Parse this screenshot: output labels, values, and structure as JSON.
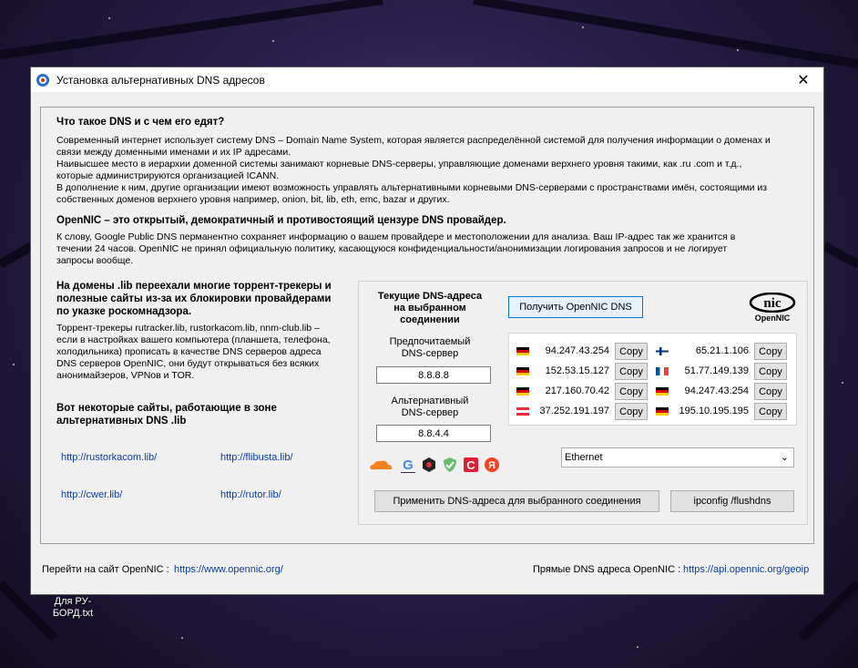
{
  "desktop": {
    "icon_label": "Для РУ-БОРД.txt"
  },
  "window": {
    "title": "Установка альтернативных DNS адресов",
    "close_glyph": "✕"
  },
  "intro": {
    "heading": "Что такое DNS и с чем его едят?",
    "lines": [
      "Современный интернет использует систему DNS – Domain Name System, которая является распределённой системой для получения информации о доменах и",
      "связи между доменными именами и их IP адресами.",
      "Наивысшее место в иерархии доменной системы занимают корневые DNS-серверы, управляющие доменами верхнего уровня такими, как .ru .com и т.д.,",
      "которые администрируются организацией ICANN.",
      "В дополнение к ним, другие организации имеют возможность управлять альтернативными корневыми DNS-серверами с пространствами имён, состоящими из",
      "собственных доменов верхнего уровня например, onion, bit, lib, eth, emc, bazar и других."
    ]
  },
  "opennic": {
    "heading": "OpenNIC – это открытый, демократичный и противостоящий цензуре DNS провайдер.",
    "lines": [
      "К слову, Google Public DNS перманентно сохраняет информацию о вашем провайдере и местоположении для анализа. Ваш IP-адрес так же хранится в",
      "течении 24 часов. OpenNIC не принял официальную политику, касающуюся конфиденциальности/анонимизации логирования запросов и не логирует",
      "запросы вообще."
    ]
  },
  "lib": {
    "heading_lines": [
      "На домены .lib переехали многие торрент-трекеры и",
      "полезные сайты из-за их блокировки провайдерами",
      "по указке роскомнадзора."
    ],
    "lines": [
      "Торрент-трекеры rutracker.lib, rustorkacom.lib, nnm-club.lib –",
      "если в настройках вашего компьютера (планшета, телефона,",
      "холодильника) прописать в качестве DNS серверов адреса",
      "DNS серверов OpenNIC, они будут открываться без всяких",
      "анонимайзеров, VPNов и TOR."
    ],
    "sites_heading_lines": [
      "Вот некоторые сайты, работающие в зоне",
      "альтернативных DNS .lib"
    ],
    "links": [
      "http://rustorkacom.lib/",
      "http://flibusta.lib/",
      "http://cwer.lib/",
      "http://rutor.lib/"
    ]
  },
  "panel": {
    "current_dns_lines": [
      "Текущие DNS-адреса",
      "на выбранном",
      "соединении"
    ],
    "preferred_label_lines": [
      "Предпочитаемый",
      "DNS-сервер"
    ],
    "preferred_value": "8.8.8.8",
    "alternate_label_lines": [
      "Альтернативный",
      "DNS-сервер"
    ],
    "alternate_value": "8.8.4.4",
    "get_button": "Получить OpenNIC DNS",
    "logo_top": "nic",
    "logo_bottom": "OpenNIC",
    "copy_label": "Copy",
    "servers_left": [
      {
        "flag": "de",
        "ip": "94.247.43.254"
      },
      {
        "flag": "de",
        "ip": "152.53.15.127"
      },
      {
        "flag": "de",
        "ip": "217.160.70.42"
      },
      {
        "flag": "at",
        "ip": "37.252.191.197"
      }
    ],
    "servers_right": [
      {
        "flag": "fi",
        "ip": "65.21.1.106"
      },
      {
        "flag": "fr",
        "ip": "51.77.149.139"
      },
      {
        "flag": "de",
        "ip": "94.247.43.254"
      },
      {
        "flag": "de",
        "ip": "195.10.195.195"
      }
    ],
    "connection_select": "Ethernet",
    "apply_button": "Применить DNS-адреса для выбранного соединения",
    "flush_button": "ipconfig /flushdns",
    "providers": [
      "cloudflare-icon",
      "google-icon",
      "quad9-icon",
      "adguard-icon",
      "comss-icon",
      "yandex-icon"
    ]
  },
  "footer": {
    "left_label": "Перейти на сайт OpenNIC :",
    "left_link": "https://www.opennic.org/",
    "right_label": "Прямые DNS адреса OpenNIC :",
    "right_link": "https://api.opennic.org/geoip"
  }
}
